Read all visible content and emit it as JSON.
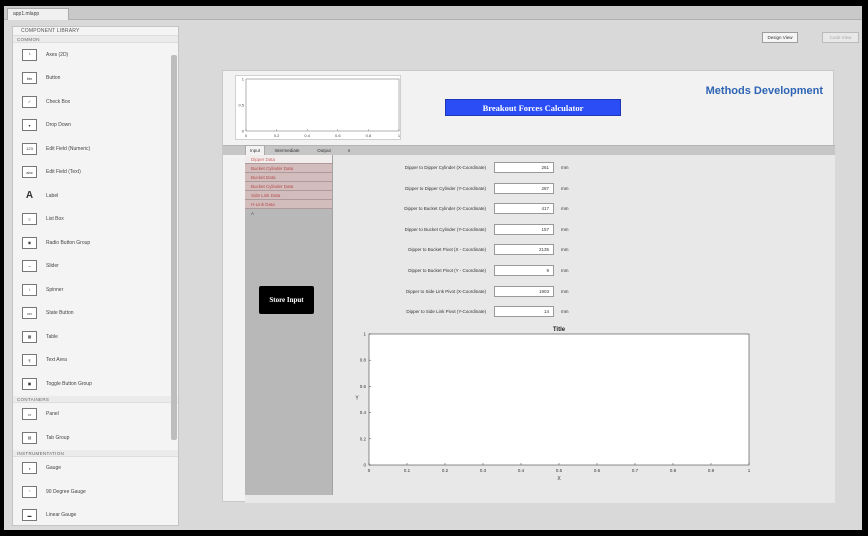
{
  "window": {
    "tab_label": "app1.mlapp"
  },
  "library": {
    "title": "COMPONENT LIBRARY",
    "sections": {
      "common": "COMMON",
      "containers": "CONTAINERS",
      "instrumentation": "INSTRUMENTATION"
    },
    "common_items": [
      {
        "label": "Axes (2D)",
        "icon": "axes-icon"
      },
      {
        "label": "Button",
        "icon": "button-icon"
      },
      {
        "label": "Check Box",
        "icon": "checkbox-icon"
      },
      {
        "label": "Drop Down",
        "icon": "dropdown-icon"
      },
      {
        "label": "Edit Field (Numeric)",
        "icon": "numeric-field-icon"
      },
      {
        "label": "Edit Field (Text)",
        "icon": "text-field-icon"
      },
      {
        "label": "Label",
        "icon": "label-icon"
      },
      {
        "label": "List Box",
        "icon": "listbox-icon"
      },
      {
        "label": "Radio Button Group",
        "icon": "radio-group-icon"
      },
      {
        "label": "Slider",
        "icon": "slider-icon"
      },
      {
        "label": "Spinner",
        "icon": "spinner-icon"
      },
      {
        "label": "State Button",
        "icon": "state-button-icon"
      },
      {
        "label": "Table",
        "icon": "table-icon"
      },
      {
        "label": "Text Area",
        "icon": "text-area-icon"
      },
      {
        "label": "Toggle Button Group",
        "icon": "toggle-group-icon"
      }
    ],
    "container_items": [
      {
        "label": "Panel",
        "icon": "panel-icon"
      },
      {
        "label": "Tab Group",
        "icon": "tab-group-icon"
      }
    ],
    "instrumentation_items": [
      {
        "label": "Gauge",
        "icon": "gauge-icon"
      },
      {
        "label": "90 Degree Gauge",
        "icon": "ninety-gauge-icon"
      },
      {
        "label": "Linear Gauge",
        "icon": "linear-gauge-icon"
      }
    ]
  },
  "toolbar": {
    "design_view": "Design View",
    "code_view": "Code View"
  },
  "app": {
    "title_button": "Breakout Forces Calculator",
    "brand": "Methods Development",
    "mini_axes": {
      "y_ticks": [
        "1",
        "0.5",
        "0"
      ],
      "x_ticks": [
        "0",
        "0.2",
        "0.4",
        "0.6",
        "0.8",
        "1"
      ]
    },
    "tabs": [
      "Input",
      "Intermediate",
      "Output"
    ],
    "tab_more": "∨",
    "side_list": [
      "Dipper Data",
      "Bucket Cylinder Data",
      "Bucket Data",
      "Bucket Cylinder Data",
      "Side Link Data",
      "H-Link Data",
      "A"
    ],
    "store_button": "Store Input",
    "fields": [
      {
        "label": "Dipper to Dipper Cylinder (X-Coordinate)",
        "value": "261",
        "unit": "mm"
      },
      {
        "label": "Dipper to Dipper Cylinder (Y-Coordinate)",
        "value": "287",
        "unit": "mm"
      },
      {
        "label": "Dipper to Bucket Cylinder (X-Coordinate)",
        "value": "417",
        "unit": "mm"
      },
      {
        "label": "Dipper to Bucket Cylinder (Y-Coordinate)",
        "value": "157",
        "unit": "mm"
      },
      {
        "label": "Dipper to Bucket Pivot (X - Coordinate)",
        "value": "2135",
        "unit": "mm"
      },
      {
        "label": "Dipper to Bucket Pivot (Y - Coordinate)",
        "value": "9",
        "unit": "mm"
      },
      {
        "label": "Dipper to Side Link Pivot (X-Coordinate)",
        "value": "1903",
        "unit": "mm"
      },
      {
        "label": "Dipper to Side Link Pivot (Y-Coordinate)",
        "value": "14",
        "unit": "mm"
      }
    ]
  },
  "chart_data": {
    "type": "line",
    "title": "Title",
    "xlabel": "X",
    "ylabel": "Y",
    "xlim": [
      0,
      1
    ],
    "ylim": [
      0,
      1
    ],
    "x_ticks": [
      "0",
      "0.1",
      "0.2",
      "0.3",
      "0.4",
      "0.5",
      "0.6",
      "0.7",
      "0.8",
      "0.9",
      "1"
    ],
    "y_ticks": [
      "0",
      "0.2",
      "0.4",
      "0.6",
      "0.8",
      "1"
    ],
    "series": []
  }
}
